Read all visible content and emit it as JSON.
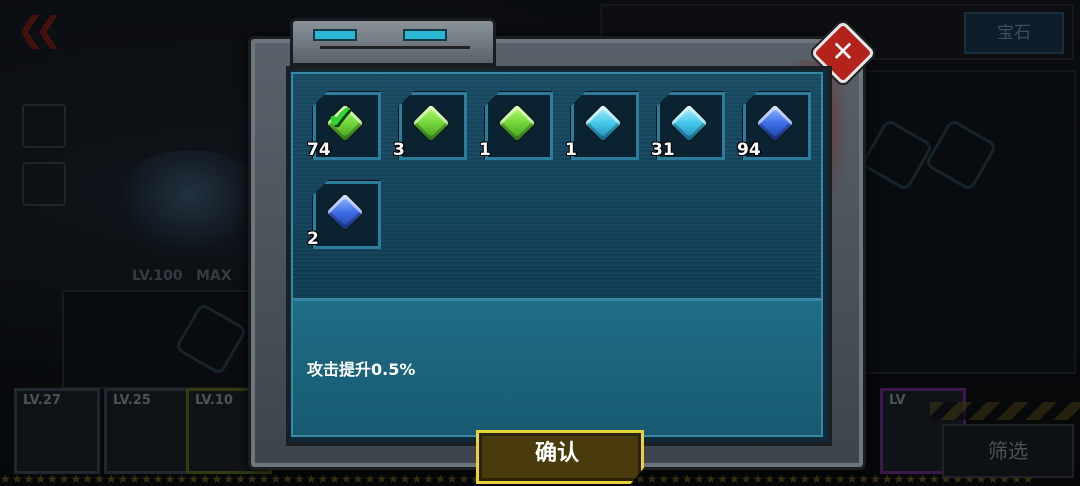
{
  "background": {
    "back_icon": "double-chevron-left-icon",
    "top_tabs": {
      "active": "宝石"
    },
    "level": {
      "lv": "LV.100",
      "max": "MAX"
    },
    "cards": [
      {
        "lv": "LV.27"
      },
      {
        "lv": "LV.25"
      },
      {
        "lv": "LV.10"
      },
      {
        "lv": "LV"
      }
    ],
    "filter_label": "筛选"
  },
  "modal": {
    "gems": [
      {
        "color": "green",
        "count": "74",
        "selected": true
      },
      {
        "color": "green",
        "count": "3",
        "selected": false
      },
      {
        "color": "green",
        "count": "1",
        "selected": false
      },
      {
        "color": "cyan",
        "count": "1",
        "selected": false
      },
      {
        "color": "cyan",
        "count": "31",
        "selected": false
      },
      {
        "color": "blue",
        "count": "94",
        "selected": false
      },
      {
        "color": "blue",
        "count": "2",
        "selected": false
      }
    ],
    "description": "攻击提升0.5%",
    "confirm_label": "确认",
    "close_icon": "close-x-icon"
  },
  "colors": {
    "accent_gold": "#e8d23a",
    "close_red": "#b3221b",
    "panel_teal": "#175a70"
  }
}
